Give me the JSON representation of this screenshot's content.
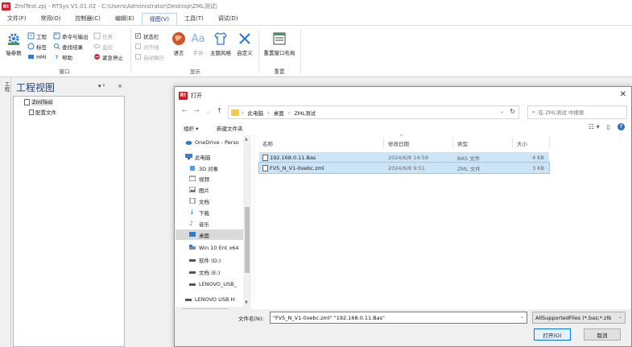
{
  "app": {
    "title": "ZmlTest.zpj - RTSys V1.01.02 - C:\\Users\\Administrator\\Desktop\\ZML测试\\",
    "icon_text": "Rt",
    "brand_color": "#c8202a"
  },
  "menu": [
    {
      "label": "文件(F)"
    },
    {
      "label": "常用(O)"
    },
    {
      "label": "控制器(C)"
    },
    {
      "label": "编辑(E)"
    },
    {
      "label": "视图(V)",
      "active": true
    },
    {
      "label": "工具(T)"
    },
    {
      "label": "调试(D)"
    }
  ],
  "ribbon": {
    "window_group": {
      "label": "窗口",
      "axis_params": "轴参数",
      "project": "工程",
      "label_item": "标签",
      "hmi": "HMI",
      "cmd_output": "命令与输出",
      "find_results": "查找结果",
      "help": "帮助",
      "task": "任务",
      "monitor": "监控",
      "emergency_stop": "紧急停止"
    },
    "display_group": {
      "label": "显示",
      "status_bar": "状态栏",
      "align_line": "对齐线",
      "auto_wrap": "自动换行",
      "language": "语言",
      "font": "字体",
      "theme": "主题风格",
      "customize": "自定义"
    },
    "reset_group": {
      "label": "重置",
      "reset_layout": "重置窗口布局"
    }
  },
  "side_strip": {
    "label": "工程"
  },
  "project_panel": {
    "title": "工程视图",
    "pin": "▾ ᵖ",
    "close": "×",
    "items": [
      {
        "label": "ZmlTest"
      },
      {
        "label": "配置文件"
      }
    ]
  },
  "dialog": {
    "title": "打开",
    "address": {
      "segments": [
        "此电脑",
        "桌面",
        "ZML测试"
      ]
    },
    "search": {
      "placeholder": "在 ZML测试 中搜索"
    },
    "commands": {
      "organize": "组织 ▾",
      "new_folder": "新建文件夹"
    },
    "nav_items": [
      {
        "label": "OneDrive - Perso",
        "icon": "cloud-icon",
        "color": "#2b7cd3"
      },
      {
        "label": "此电脑",
        "icon": "computer-icon",
        "color": "#3a7bd5"
      },
      {
        "label": "3D 对象",
        "icon": "cube-icon",
        "color": "#4aa0e6"
      },
      {
        "label": "视频",
        "icon": "video-icon",
        "color": "#555555"
      },
      {
        "label": "图片",
        "icon": "picture-icon",
        "color": "#555555"
      },
      {
        "label": "文档",
        "icon": "document-icon",
        "color": "#666666"
      },
      {
        "label": "下载",
        "icon": "download-icon",
        "color": "#2b7cd3"
      },
      {
        "label": "音乐",
        "icon": "music-icon",
        "color": "#2b7cd3"
      },
      {
        "label": "桌面",
        "icon": "desktop-icon",
        "color": "#2b7cd3",
        "selected": true
      },
      {
        "label": "Win 10 Ent x64",
        "icon": "drive-icon",
        "color": "#2b7cd3"
      },
      {
        "label": "软件 (D:)",
        "icon": "drive-icon",
        "color": "#555555"
      },
      {
        "label": "文档 (E:)",
        "icon": "drive-icon",
        "color": "#555555"
      },
      {
        "label": "LENOVO_USB_",
        "icon": "drive-icon",
        "color": "#555555"
      },
      {
        "label": "LENOVO USB H",
        "icon": "drive-icon",
        "color": "#555555"
      }
    ],
    "columns": {
      "name": "名称",
      "date": "修改日期",
      "type": "类型",
      "size": "大小"
    },
    "files": [
      {
        "name": "192.168.0.11.Bas",
        "date": "2024/6/8 14:59",
        "type": "BAS 文件",
        "size": "4 KB"
      },
      {
        "name": "FV5_N_V1-0xebc.zml",
        "date": "2024/6/8 9:51",
        "type": "ZML 文件",
        "size": "3 KB"
      }
    ],
    "filename_label": "文件名(N):",
    "filename_value": "\"FV5_N_V1-0xebc.zml\" \"192.168.0.11.Bas\"",
    "filter_value": "AllSupportedFiles (*.bas;*.zlb",
    "open_button": "打开(O)",
    "cancel_button": "取消"
  }
}
